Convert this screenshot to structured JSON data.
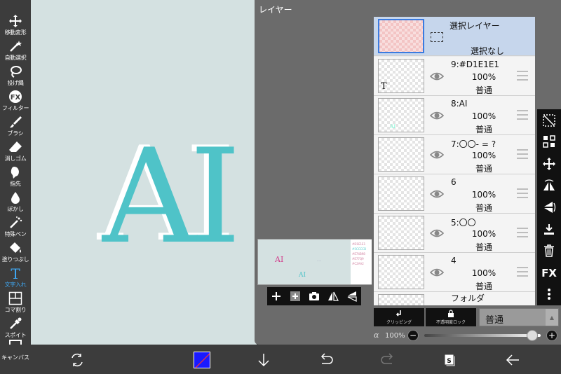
{
  "left_toolbar": {
    "tools": [
      {
        "label": "移動変形",
        "icon": "move-icon"
      },
      {
        "label": "自動選択",
        "icon": "magic-wand-icon"
      },
      {
        "label": "投げ縄",
        "icon": "lasso-icon"
      },
      {
        "label": "フィルター",
        "icon": "fx-icon"
      },
      {
        "label": "ブラシ",
        "icon": "brush-icon"
      },
      {
        "label": "消しゴム",
        "icon": "eraser-icon"
      },
      {
        "label": "指先",
        "icon": "finger-icon"
      },
      {
        "label": "ぼかし",
        "icon": "blur-icon"
      },
      {
        "label": "特殊ペン",
        "icon": "special-pen-icon"
      },
      {
        "label": "塗りつぶし",
        "icon": "fill-icon"
      },
      {
        "label": "文字入れ",
        "icon": "text-icon"
      },
      {
        "label": "コマ割り",
        "icon": "frame-divider-icon"
      },
      {
        "label": "スポイト",
        "icon": "eyedropper-icon"
      },
      {
        "label": "キャンバス",
        "icon": "canvas-icon"
      }
    ],
    "active_index": 10,
    "active_color": "#3fa9f5"
  },
  "canvas": {
    "text": "AI",
    "background": "#d4e1e1",
    "text_color": "#4fc3c8"
  },
  "layer_panel": {
    "title": "レイヤー",
    "preview": {
      "ai_text": "AI",
      "palette": [
        "#D1E1E1",
        "#5CCCCD",
        "#E74B98",
        "#E77Q9",
        "#C2AA2"
      ]
    },
    "selection_layer": {
      "name": "選択レイヤー",
      "status": "選択なし"
    },
    "layers": [
      {
        "name": "9:#D1E1E1",
        "opacity": "100%",
        "mode": "普通",
        "thumb": "text"
      },
      {
        "name": "8:AI",
        "opacity": "100%",
        "mode": "普通",
        "thumb": "ai"
      },
      {
        "name": "7:〇〇- = ?",
        "opacity": "100%",
        "mode": "普通",
        "thumb": "blank"
      },
      {
        "name": "6",
        "opacity": "100%",
        "mode": "普通",
        "thumb": "blank"
      },
      {
        "name": "5:〇〇",
        "opacity": "100%",
        "mode": "普通",
        "thumb": "blank"
      },
      {
        "name": "4",
        "opacity": "100%",
        "mode": "普通",
        "thumb": "blank"
      }
    ],
    "folder_label": "フォルダ",
    "clipping_label": "クリッピング",
    "lock_label": "不透明度ロック",
    "blend_mode": "普通",
    "alpha_symbol": "α",
    "alpha_value": "100%",
    "opacity_fraction": 1.0,
    "minus_label": "−",
    "plus_label": "+",
    "side_tools": [
      "select-layer-icon",
      "transform-icon",
      "move-icon",
      "flip-horizontal-icon",
      "flip-vertical-icon",
      "merge-down-icon",
      "trash-icon",
      "fx-icon",
      "more-icon"
    ],
    "fx_label": "FX"
  },
  "bottom_bar": {
    "color_swatch": "#1a1aff"
  }
}
